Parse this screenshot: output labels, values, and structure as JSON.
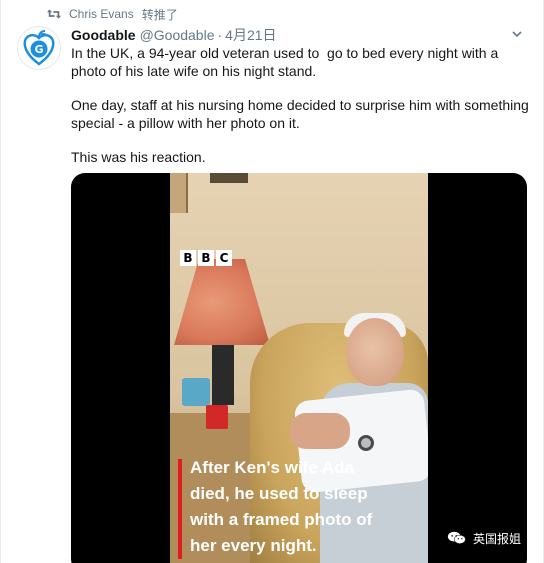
{
  "retweet": {
    "user": "Chris Evans",
    "label": "转推了",
    "icon": "retweet-icon"
  },
  "tweet": {
    "display_name": "Goodable",
    "handle": "@Goodable",
    "separator": "·",
    "date": "4月21日",
    "avatar_letter": "G",
    "paragraphs": [
      "In the UK, a 94-year old veteran used to  go to bed every night with a photo of his late wife on his night stand.",
      "One day, staff at his nursing home decided to surprise him with something special - a pillow with her photo on it.",
      "This was his reaction."
    ]
  },
  "media": {
    "broadcaster_letters": [
      "B",
      "B",
      "C"
    ],
    "caption_lines": [
      "After Ken's wife Ada",
      "died, he used to sleep",
      "with a framed photo of",
      "her every night."
    ]
  },
  "watermark": {
    "text": "英国报姐",
    "icon": "wechat-icon"
  },
  "colors": {
    "text": "#14171a",
    "secondary": "#657786",
    "avatar_blue": "#1d8fe1",
    "caption_accent": "#e01b22"
  }
}
